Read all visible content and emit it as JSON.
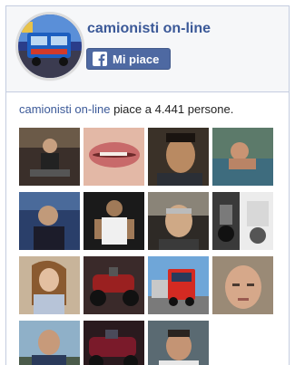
{
  "page": {
    "name": "camionisti on-line",
    "like_label": "Mi piace"
  },
  "stats": {
    "page_link": "camionisti on-line",
    "text": "piace a 4.441 persone."
  },
  "icons": {
    "facebook": "facebook-f-icon"
  },
  "colors": {
    "brand": "#3b5998",
    "button": "#4e69a2",
    "header_bg": "#f6f7f9",
    "border": "#c4cde0"
  },
  "faces": [
    {
      "subject": "man-on-motorbike-at-night"
    },
    {
      "subject": "close-up-lips"
    },
    {
      "subject": "young-man-portrait"
    },
    {
      "subject": "man-swimming"
    },
    {
      "subject": "man-in-vehicle"
    },
    {
      "subject": "man-in-white-tank-top"
    },
    {
      "subject": "man-in-car"
    },
    {
      "subject": "motorcycle-and-logo"
    },
    {
      "subject": "woman-with-long-hair"
    },
    {
      "subject": "red-motorcycle"
    },
    {
      "subject": "red-truck"
    },
    {
      "subject": "bald-man-selfie"
    },
    {
      "subject": "man-outdoors"
    },
    {
      "subject": "motorcycle-dark"
    },
    {
      "subject": "man-smiling"
    }
  ]
}
